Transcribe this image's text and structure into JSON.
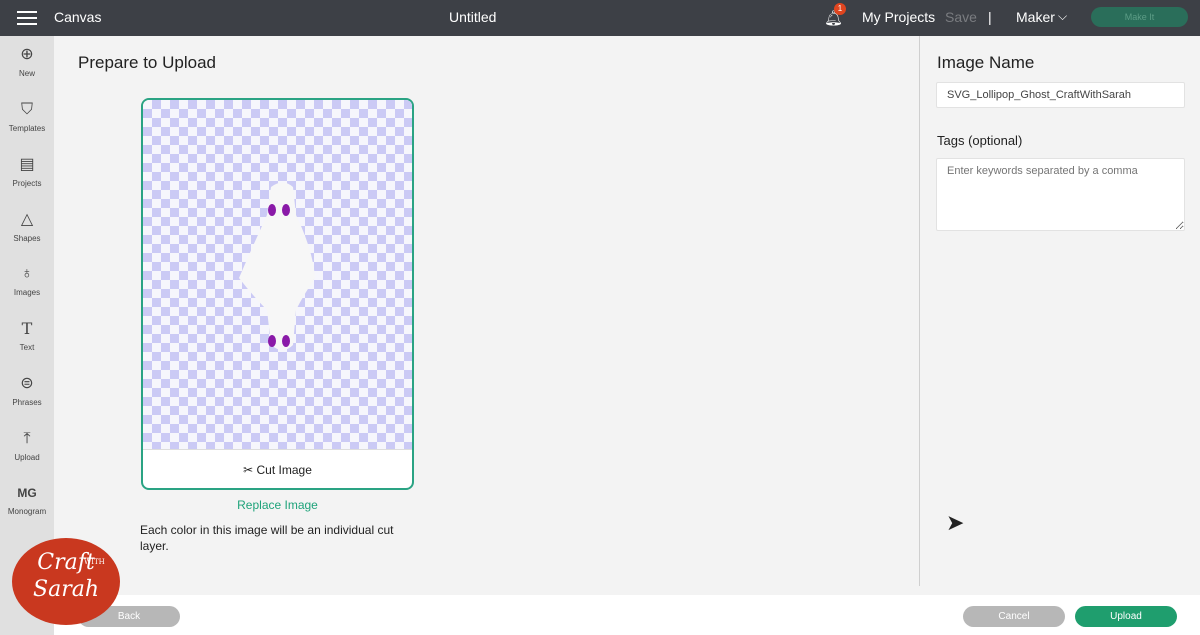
{
  "header": {
    "app": "Canvas",
    "title": "Untitled",
    "notification_count": "1",
    "my_projects": "My Projects",
    "save": "Save",
    "separator": "|",
    "machine": "Maker",
    "make_it": "Make It"
  },
  "sidebar": {
    "items": [
      {
        "label": "New",
        "icon": "⊕"
      },
      {
        "label": "Templates",
        "icon": "👕"
      },
      {
        "label": "Projects",
        "icon": "📋"
      },
      {
        "label": "Shapes",
        "icon": "△"
      },
      {
        "label": "Images",
        "icon": "💡"
      },
      {
        "label": "Text",
        "icon": "T"
      },
      {
        "label": "Phrases",
        "icon": "💬"
      },
      {
        "label": "Upload",
        "icon": "⤒"
      },
      {
        "label": "Monogram",
        "icon": "MG"
      }
    ]
  },
  "main": {
    "title": "Prepare to Upload",
    "cut_image": "Cut Image",
    "replace_image": "Replace Image",
    "note": "Each color in this image will be an individual cut layer."
  },
  "panel": {
    "image_name_label": "Image Name",
    "image_name_value": "SVG_Lollipop_Ghost_CraftWithSarah",
    "tags_label": "Tags (optional)",
    "tags_placeholder": "Enter keywords separated by a comma"
  },
  "footer": {
    "back": "Back",
    "cancel": "Cancel",
    "upload": "Upload"
  },
  "watermark": {
    "line1": "Craft",
    "with": "WITH",
    "line2": "Sarah"
  },
  "colors": {
    "accent": "#1ea37a",
    "topbar": "#3d4046",
    "eyes": "#8a1aa8"
  }
}
